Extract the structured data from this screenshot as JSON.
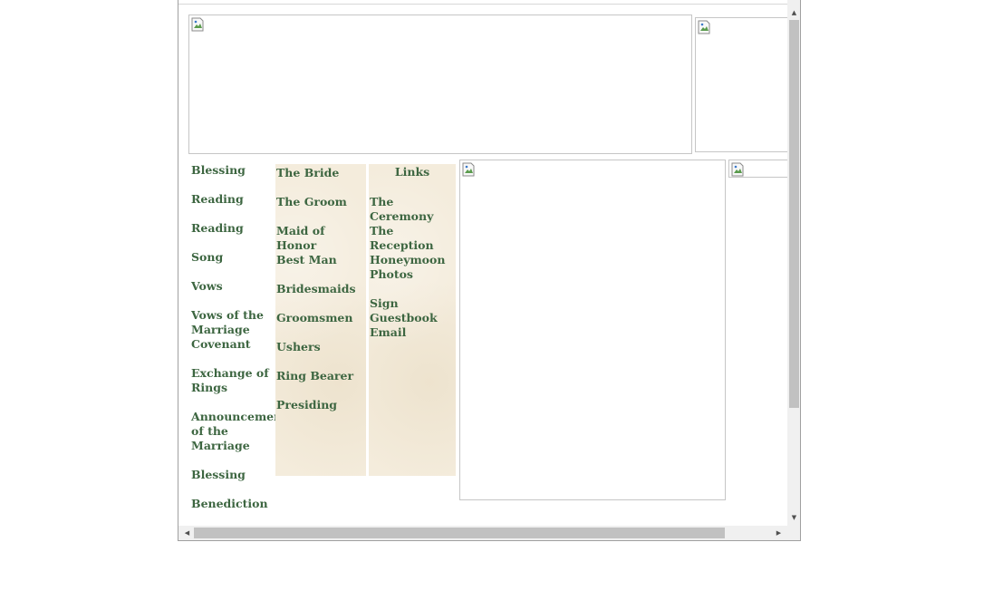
{
  "program_links": [
    "Blessing",
    "Reading",
    "Reading",
    "Song",
    "Vows",
    "Vows of the Marriage Covenant",
    "Exchange of Rings",
    "Announcement of the Marriage",
    "Blessing",
    "Benediction"
  ],
  "party_links": [
    "The Bride",
    "The Groom",
    "Maid of Honor",
    "Best Man",
    "Bridesmaids",
    "Groomsmen",
    "Ushers",
    "Ring Bearer",
    "Presiding"
  ],
  "links_section": {
    "heading": "Links",
    "items": [
      "The Ceremony",
      "The Reception",
      "Honeymoon Photos",
      "Sign Guestbook",
      "Email"
    ]
  },
  "partial_heading": "",
  "icons": {
    "broken_image": "broken-image-icon",
    "scroll_up": "scroll-up-arrow-icon",
    "scroll_down": "scroll-down-arrow-icon",
    "scroll_left": "scroll-left-arrow-icon",
    "scroll_right": "scroll-right-arrow-icon"
  },
  "colors": {
    "link": "#3d6641",
    "parchment": "#f4ecdc",
    "heading": "#2c5a33"
  }
}
